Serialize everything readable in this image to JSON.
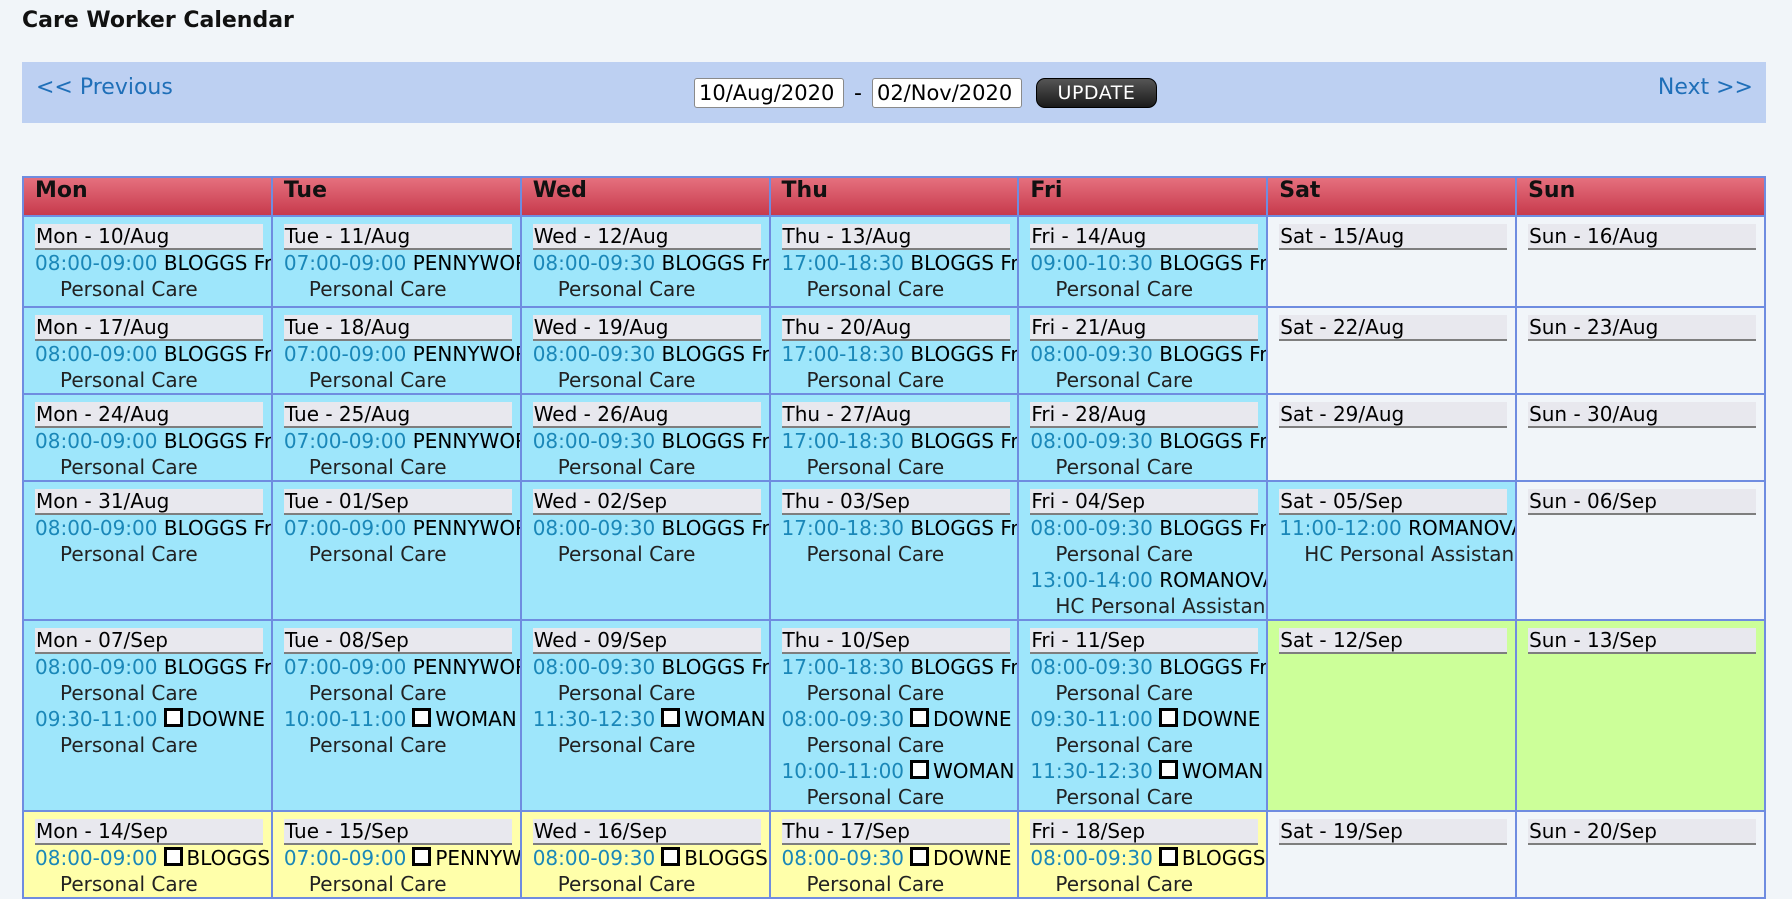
{
  "title": "Care Worker Calendar",
  "nav": {
    "prev": "<< Previous",
    "next": "Next >>",
    "from": "10/Aug/2020",
    "to": "02/Nov/2020",
    "dash": "-",
    "update": "UPDATE"
  },
  "days": [
    "Mon",
    "Tue",
    "Wed",
    "Thu",
    "Fri",
    "Sat",
    "Sun"
  ],
  "weeks": [
    {
      "height": 91,
      "cells": [
        {
          "date": "Mon - 10/Aug",
          "bg": "blue",
          "appts": [
            {
              "time": "08:00-09:00",
              "client": "BLOGGS Fred",
              "care": "Personal Care"
            }
          ]
        },
        {
          "date": "Tue - 11/Aug",
          "bg": "blue",
          "appts": [
            {
              "time": "07:00-09:00",
              "client": "PENNYWORTH",
              "care": "Personal Care"
            }
          ]
        },
        {
          "date": "Wed - 12/Aug",
          "bg": "blue",
          "appts": [
            {
              "time": "08:00-09:30",
              "client": "BLOGGS Fred",
              "care": "Personal Care"
            }
          ]
        },
        {
          "date": "Thu - 13/Aug",
          "bg": "blue",
          "appts": [
            {
              "time": "17:00-18:30",
              "client": "BLOGGS Fred",
              "care": "Personal Care"
            }
          ]
        },
        {
          "date": "Fri - 14/Aug",
          "bg": "blue",
          "appts": [
            {
              "time": "09:00-10:30",
              "client": "BLOGGS Fred",
              "care": "Personal Care"
            }
          ]
        },
        {
          "date": "Sat - 15/Aug",
          "bg": "empty",
          "appts": []
        },
        {
          "date": "Sun - 16/Aug",
          "bg": "empty",
          "appts": []
        }
      ]
    },
    {
      "height": 82,
      "cells": [
        {
          "date": "Mon - 17/Aug",
          "bg": "blue",
          "appts": [
            {
              "time": "08:00-09:00",
              "client": "BLOGGS Fred",
              "care": "Personal Care"
            }
          ]
        },
        {
          "date": "Tue - 18/Aug",
          "bg": "blue",
          "appts": [
            {
              "time": "07:00-09:00",
              "client": "PENNYWORTH",
              "care": "Personal Care"
            }
          ]
        },
        {
          "date": "Wed - 19/Aug",
          "bg": "blue",
          "appts": [
            {
              "time": "08:00-09:30",
              "client": "BLOGGS Fred",
              "care": "Personal Care"
            }
          ]
        },
        {
          "date": "Thu - 20/Aug",
          "bg": "blue",
          "appts": [
            {
              "time": "17:00-18:30",
              "client": "BLOGGS Fred",
              "care": "Personal Care"
            }
          ]
        },
        {
          "date": "Fri - 21/Aug",
          "bg": "blue",
          "appts": [
            {
              "time": "08:00-09:30",
              "client": "BLOGGS Fred",
              "care": "Personal Care"
            }
          ]
        },
        {
          "date": "Sat - 22/Aug",
          "bg": "empty",
          "appts": []
        },
        {
          "date": "Sun - 23/Aug",
          "bg": "empty",
          "appts": []
        }
      ]
    },
    {
      "height": 82,
      "cells": [
        {
          "date": "Mon - 24/Aug",
          "bg": "blue",
          "appts": [
            {
              "time": "08:00-09:00",
              "client": "BLOGGS Fred",
              "care": "Personal Care"
            }
          ]
        },
        {
          "date": "Tue - 25/Aug",
          "bg": "blue",
          "appts": [
            {
              "time": "07:00-09:00",
              "client": "PENNYWORTH",
              "care": "Personal Care"
            }
          ]
        },
        {
          "date": "Wed - 26/Aug",
          "bg": "blue",
          "appts": [
            {
              "time": "08:00-09:30",
              "client": "BLOGGS Fred",
              "care": "Personal Care"
            }
          ]
        },
        {
          "date": "Thu - 27/Aug",
          "bg": "blue",
          "appts": [
            {
              "time": "17:00-18:30",
              "client": "BLOGGS Fred",
              "care": "Personal Care"
            }
          ]
        },
        {
          "date": "Fri - 28/Aug",
          "bg": "blue",
          "appts": [
            {
              "time": "08:00-09:30",
              "client": "BLOGGS Fred",
              "care": "Personal Care"
            }
          ]
        },
        {
          "date": "Sat - 29/Aug",
          "bg": "empty",
          "appts": []
        },
        {
          "date": "Sun - 30/Aug",
          "bg": "empty",
          "appts": []
        }
      ]
    },
    {
      "height": 128,
      "cells": [
        {
          "date": "Mon - 31/Aug",
          "bg": "blue",
          "appts": [
            {
              "time": "08:00-09:00",
              "client": "BLOGGS Fred",
              "care": "Personal Care"
            }
          ]
        },
        {
          "date": "Tue - 01/Sep",
          "bg": "blue",
          "appts": [
            {
              "time": "07:00-09:00",
              "client": "PENNYWORTH",
              "care": "Personal Care"
            }
          ]
        },
        {
          "date": "Wed - 02/Sep",
          "bg": "blue",
          "appts": [
            {
              "time": "08:00-09:30",
              "client": "BLOGGS Fred",
              "care": "Personal Care"
            }
          ]
        },
        {
          "date": "Thu - 03/Sep",
          "bg": "blue",
          "appts": [
            {
              "time": "17:00-18:30",
              "client": "BLOGGS Fred",
              "care": "Personal Care"
            }
          ]
        },
        {
          "date": "Fri - 04/Sep",
          "bg": "blue",
          "appts": [
            {
              "time": "08:00-09:30",
              "client": "BLOGGS Fred",
              "care": "Personal Care"
            },
            {
              "time": "13:00-14:00",
              "client": "ROMANOVA N",
              "care": "HC Personal Assistance"
            }
          ]
        },
        {
          "date": "Sat - 05/Sep",
          "bg": "blue",
          "appts": [
            {
              "time": "11:00-12:00",
              "client": "ROMANOVA N",
              "care": "HC Personal Assistance"
            }
          ]
        },
        {
          "date": "Sun - 06/Sep",
          "bg": "empty",
          "appts": []
        }
      ]
    },
    {
      "height": 173,
      "cells": [
        {
          "date": "Mon - 07/Sep",
          "bg": "blue",
          "appts": [
            {
              "time": "08:00-09:00",
              "client": "BLOGGS Fred",
              "care": "Personal Care"
            },
            {
              "time": "09:30-11:00",
              "box": true,
              "client": "DOWNE Roger",
              "care": "Personal Care"
            }
          ]
        },
        {
          "date": "Tue - 08/Sep",
          "bg": "blue",
          "appts": [
            {
              "time": "07:00-09:00",
              "client": "PENNYWORTH",
              "care": "Personal Care"
            },
            {
              "time": "10:00-11:00",
              "box": true,
              "client": "WOMAN Cat",
              "care": "Personal Care"
            }
          ]
        },
        {
          "date": "Wed - 09/Sep",
          "bg": "blue",
          "appts": [
            {
              "time": "08:00-09:30",
              "client": "BLOGGS Fred",
              "care": "Personal Care"
            },
            {
              "time": "11:30-12:30",
              "box": true,
              "client": "WOMAN Cat",
              "care": "Personal Care"
            }
          ]
        },
        {
          "date": "Thu - 10/Sep",
          "bg": "blue",
          "appts": [
            {
              "time": "17:00-18:30",
              "client": "BLOGGS Fred",
              "care": "Personal Care"
            },
            {
              "time": "08:00-09:30",
              "box": true,
              "client": "DOWNE Roger",
              "care": "Personal Care"
            },
            {
              "time": "10:00-11:00",
              "box": true,
              "client": "WOMAN Cat",
              "care": "Personal Care"
            }
          ]
        },
        {
          "date": "Fri - 11/Sep",
          "bg": "blue",
          "appts": [
            {
              "time": "08:00-09:30",
              "client": "BLOGGS Fred",
              "care": "Personal Care"
            },
            {
              "time": "09:30-11:00",
              "box": true,
              "client": "DOWNE Roger",
              "care": "Personal Care"
            },
            {
              "time": "11:30-12:30",
              "box": true,
              "client": "WOMAN Cat",
              "care": "Personal Care"
            }
          ]
        },
        {
          "date": "Sat - 12/Sep",
          "bg": "green",
          "appts": []
        },
        {
          "date": "Sun - 13/Sep",
          "bg": "green",
          "appts": []
        }
      ]
    },
    {
      "height": 60,
      "cells": [
        {
          "date": "Mon - 14/Sep",
          "bg": "yellow",
          "appts": [
            {
              "time": "08:00-09:00",
              "box": true,
              "client": "BLOGGS Fred",
              "care": "Personal Care"
            }
          ]
        },
        {
          "date": "Tue - 15/Sep",
          "bg": "yellow",
          "appts": [
            {
              "time": "07:00-09:00",
              "box": true,
              "client": "PENNYWORTH",
              "care": "Personal Care"
            }
          ]
        },
        {
          "date": "Wed - 16/Sep",
          "bg": "yellow",
          "appts": [
            {
              "time": "08:00-09:30",
              "box": true,
              "client": "BLOGGS Fred",
              "care": "Personal Care"
            }
          ]
        },
        {
          "date": "Thu - 17/Sep",
          "bg": "yellow",
          "appts": [
            {
              "time": "08:00-09:30",
              "box": true,
              "client": "DOWNE Roger",
              "care": "Personal Care"
            }
          ]
        },
        {
          "date": "Fri - 18/Sep",
          "bg": "yellow",
          "appts": [
            {
              "time": "08:00-09:30",
              "box": true,
              "client": "BLOGGS Fred",
              "care": "Personal Care"
            }
          ]
        },
        {
          "date": "Sat - 19/Sep",
          "bg": "empty",
          "appts": []
        },
        {
          "date": "Sun - 20/Sep",
          "bg": "empty",
          "appts": []
        }
      ]
    }
  ]
}
